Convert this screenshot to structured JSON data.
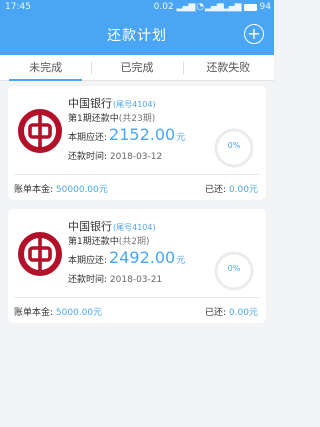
{
  "status_bar": {
    "time": "17:45",
    "speed": "0.02",
    "battery": "94",
    "colors": {
      "bg": "#4aa6f4"
    }
  },
  "header": {
    "title": "还款计划",
    "add_icon": "plus-circle-icon"
  },
  "tabs": [
    {
      "label": "未完成",
      "active": true
    },
    {
      "label": "已完成",
      "active": false
    },
    {
      "label": "还款失败",
      "active": false
    }
  ],
  "labels": {
    "due": "本期应还:",
    "date": "还款时间:",
    "principal": "账单本金:",
    "repaid": "已还:",
    "yuan": "元"
  },
  "cards": [
    {
      "bank": "中国银行",
      "tail": "(尾号4104)",
      "period": "第1期还款中",
      "total": "(共23期)",
      "amount": "2152.00",
      "date": "2018-03-12",
      "progress": "0%",
      "principal": "50000.00元",
      "repaid": "0.00元"
    },
    {
      "bank": "中国银行",
      "tail": "(尾号4104)",
      "period": "第1期还款中",
      "total": "(共2期)",
      "amount": "2492.00",
      "date": "2018-03-21",
      "progress": "0%",
      "principal": "5000.00元",
      "repaid": "0.00元"
    }
  ],
  "colors": {
    "accent": "#4aa6f4",
    "bank_red": "#b3112a"
  }
}
